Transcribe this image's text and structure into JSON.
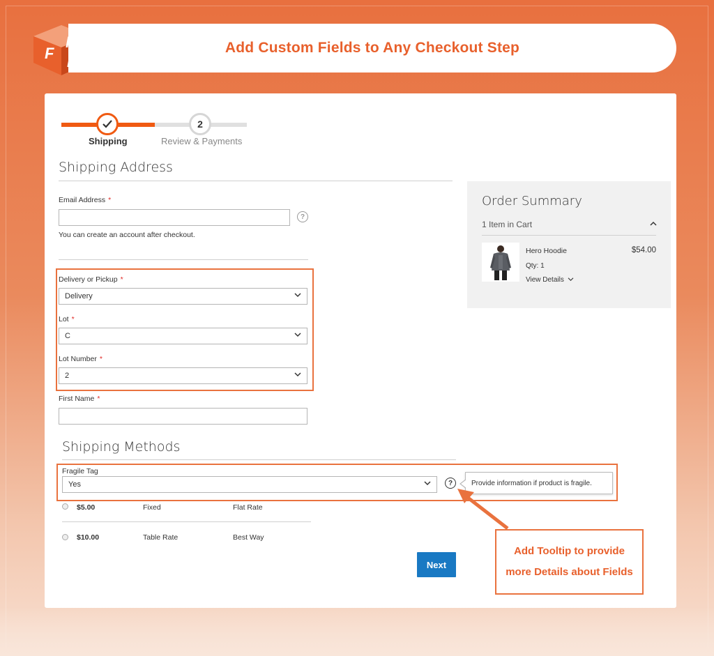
{
  "banner": {
    "title": "Add Custom Fields to Any Checkout Step"
  },
  "logo": {
    "alt": "FME"
  },
  "progress": {
    "steps": [
      {
        "number": "",
        "label": "Shipping",
        "state": "complete"
      },
      {
        "number": "2",
        "label": "Review & Payments",
        "state": "upcoming"
      }
    ]
  },
  "shipping_address": {
    "title": "Shipping Address",
    "email": {
      "label": "Email Address",
      "required_mark": "*",
      "value": "",
      "help": "?"
    },
    "email_note": "You can create an account after checkout.",
    "delivery": {
      "label": "Delivery or Pickup",
      "required_mark": "*",
      "value": "Delivery"
    },
    "lot": {
      "label": "Lot",
      "required_mark": "*",
      "value": "C"
    },
    "lot_number": {
      "label": "Lot Number",
      "required_mark": "*",
      "value": "2"
    },
    "first_name": {
      "label": "First Name",
      "required_mark": "*",
      "value": ""
    }
  },
  "shipping_methods": {
    "title": "Shipping Methods",
    "fragile": {
      "label": "Fragile Tag",
      "value": "Yes",
      "help": "?"
    },
    "tooltip": "Provide information if product is fragile.",
    "rates": [
      {
        "price": "$5.00",
        "method": "Fixed",
        "carrier": "Flat Rate"
      },
      {
        "price": "$10.00",
        "method": "Table Rate",
        "carrier": "Best Way"
      }
    ],
    "next_label": "Next"
  },
  "order_summary": {
    "title": "Order Summary",
    "count": "1 Item in Cart",
    "item": {
      "name": "Hero Hoodie",
      "qty": "Qty: 1",
      "view": "View Details",
      "price": "$54.00"
    }
  },
  "callout": {
    "line1": "Add Tooltip to provide",
    "line2": "more Details about Fields"
  },
  "colors": {
    "accent": "#e8602c",
    "progress": "#f05a12",
    "button": "#1979c3",
    "required": "#e02b27"
  }
}
